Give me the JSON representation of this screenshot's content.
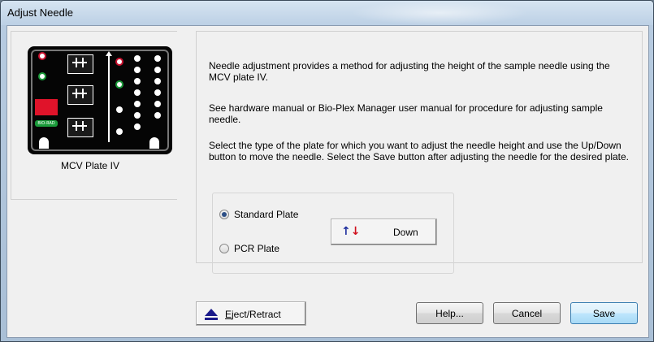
{
  "window": {
    "title": "Adjust Needle"
  },
  "plate": {
    "label": "MCV Plate IV",
    "badge": "BIO-RAD"
  },
  "info": {
    "p1": "Needle adjustment provides a method for adjusting the height of the sample needle using the MCV plate IV.",
    "p2": "See hardware manual or Bio-Plex Manager user manual for procedure for adjusting sample needle.",
    "p3": "Select the type of the plate for which you want to adjust the needle height and use the Up/Down button to move the needle. Select the Save button after adjusting the needle for the desired plate."
  },
  "plate_type": {
    "options": [
      "Standard Plate",
      "PCR Plate"
    ],
    "selected": "Standard Plate"
  },
  "buttons": {
    "updown": "Down",
    "eject_prefix": "E",
    "eject_rest": "ject/Retract",
    "help": "Help...",
    "cancel": "Cancel",
    "save": "Save"
  },
  "colors": {
    "arrow_up": "#1f2f9e",
    "arrow_down": "#d0101e",
    "accent": "#3c7fb1"
  }
}
